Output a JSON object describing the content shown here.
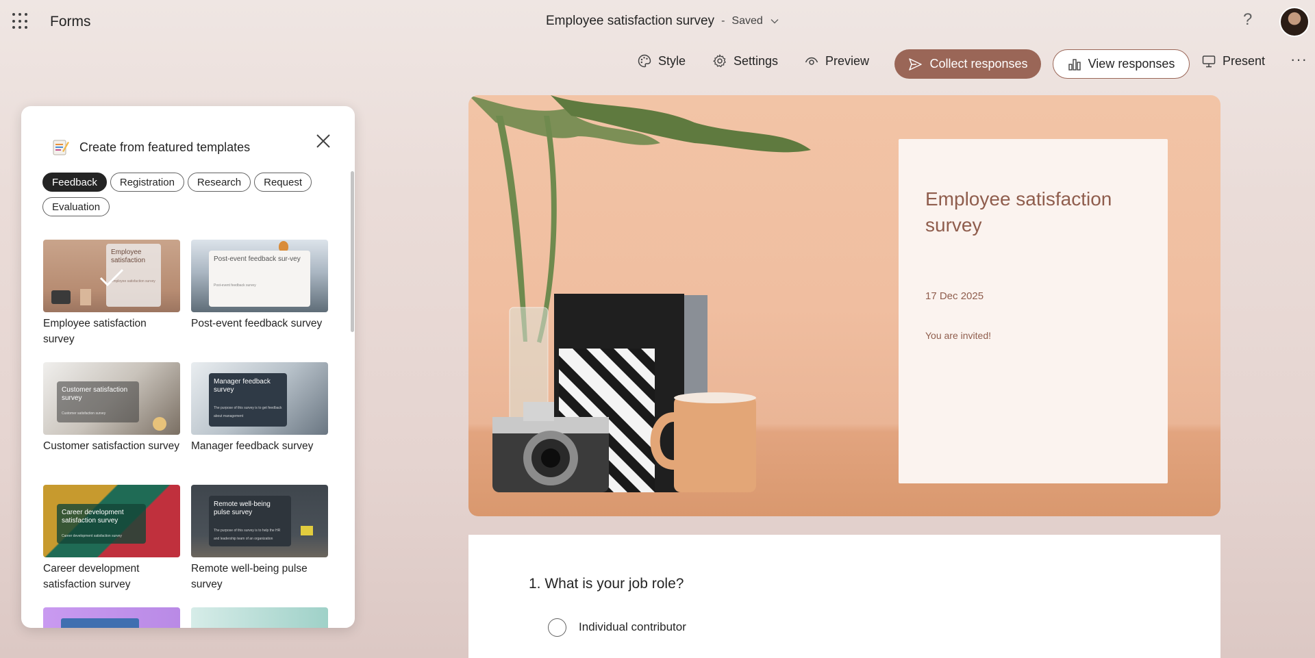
{
  "app": {
    "name": "Forms"
  },
  "document": {
    "title": "Employee satisfaction survey",
    "separator": "-",
    "status": "Saved"
  },
  "toolbar": {
    "style": "Style",
    "settings": "Settings",
    "preview": "Preview",
    "collect": "Collect responses",
    "view": "View responses",
    "present": "Present"
  },
  "panel": {
    "title": "Create from featured templates",
    "chips": [
      "Feedback",
      "Registration",
      "Research",
      "Request",
      "Evaluation"
    ],
    "active_chip": "Feedback",
    "templates": [
      {
        "label": "Employee satisfaction survey",
        "thumb_title": "Employee satisfaction",
        "thumb_sub": "Employee satisfaction survey",
        "selected": true
      },
      {
        "label": "Post-event feedback survey",
        "thumb_title": "Post-event feedback sur-vey",
        "thumb_sub": "Post-event feedback survey"
      },
      {
        "label": "Customer satisfaction survey",
        "thumb_title": "Customer satisfaction survey",
        "thumb_sub": "Customer satisfaction survey"
      },
      {
        "label": "Manager feedback survey",
        "thumb_title": "Manager feedback survey",
        "thumb_sub": "The purpose of this survey is to get feedback about management"
      },
      {
        "label": "Career development satisfaction survey",
        "thumb_title": "Career development satisfaction survey",
        "thumb_sub": "Career development satisfaction survey"
      },
      {
        "label": "Remote well-being pulse survey",
        "thumb_title": "Remote well-being pulse survey",
        "thumb_sub": "The purpose of this survey is to help the HR and leadership team of an organization"
      }
    ]
  },
  "cover": {
    "title": "Employee satisfaction survey",
    "date": "17 Dec 2025",
    "invite": "You are invited!"
  },
  "questions": [
    {
      "number": "1.",
      "text": "What is your job role?",
      "options": [
        "Individual contributor"
      ]
    }
  ],
  "colors": {
    "accent": "#9a6657",
    "cover_text": "#8f5d4d",
    "cover_bg": "#f0bea0"
  },
  "icons": [
    "app-launcher-icon",
    "help-icon",
    "style-icon",
    "settings-icon",
    "preview-icon",
    "send-icon",
    "chart-icon",
    "present-icon",
    "more-icon",
    "close-icon",
    "template-icon",
    "checkmark-icon"
  ]
}
